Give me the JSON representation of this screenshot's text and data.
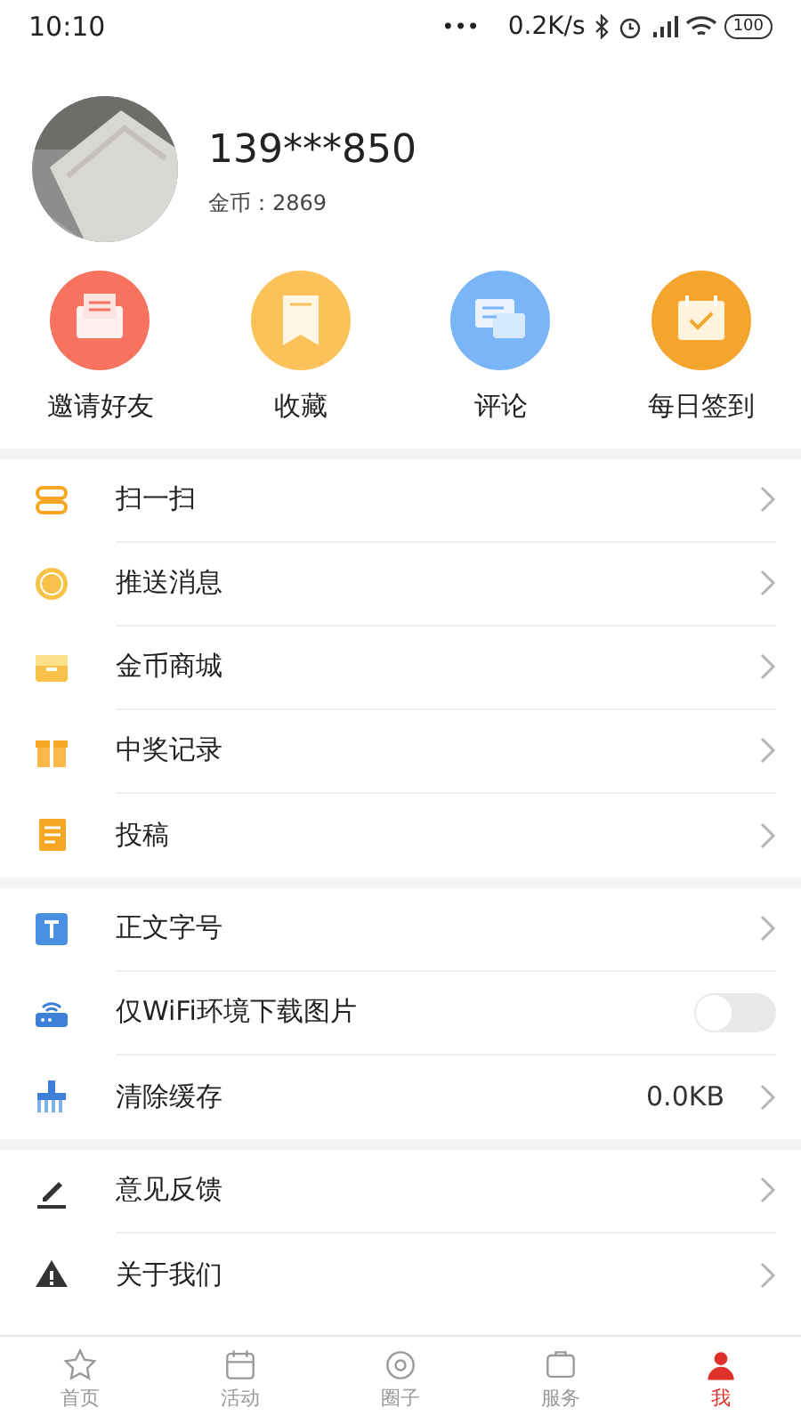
{
  "status_bar": {
    "time": "10:10",
    "dots": "•••",
    "speed": "0.2K/s",
    "battery": "100"
  },
  "profile": {
    "name": "139***850",
    "coins_label": "金币：",
    "coins": "2869"
  },
  "shortcuts": [
    {
      "label": "邀请好友",
      "color": "#f7735f"
    },
    {
      "label": "收藏",
      "color": "#fbc25a"
    },
    {
      "label": "评论",
      "color": "#7ab6f7"
    },
    {
      "label": "每日签到",
      "color": "#f3a52d"
    }
  ],
  "sections": [
    [
      {
        "kind": "link",
        "label": "扫一扫"
      },
      {
        "kind": "link",
        "label": "推送消息"
      },
      {
        "kind": "link",
        "label": "金币商城"
      },
      {
        "kind": "link",
        "label": "中奖记录"
      },
      {
        "kind": "link",
        "label": "投稿"
      }
    ],
    [
      {
        "kind": "link",
        "label": "正文字号"
      },
      {
        "kind": "toggle",
        "label": "仅WiFi环境下载图片",
        "on": false
      },
      {
        "kind": "value",
        "label": "清除缓存",
        "value": "0.0KB"
      }
    ],
    [
      {
        "kind": "link",
        "label": "意见反馈"
      },
      {
        "kind": "link",
        "label": "关于我们"
      }
    ]
  ],
  "tab_bar": [
    {
      "label": "首页",
      "selected": false
    },
    {
      "label": "活动",
      "selected": false
    },
    {
      "label": "圈子",
      "selected": false
    },
    {
      "label": "服务",
      "selected": false
    },
    {
      "label": "我",
      "selected": true
    }
  ]
}
